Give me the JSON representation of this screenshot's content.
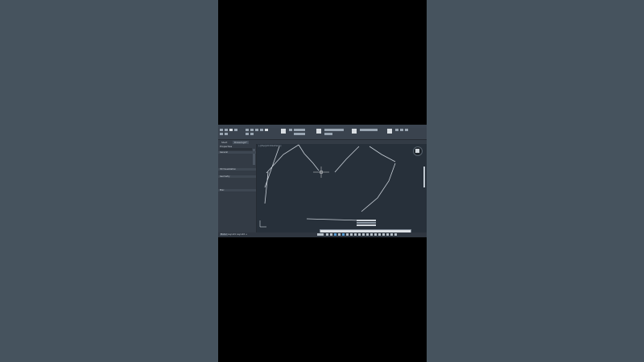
{
  "colors": {
    "letterbox": "#46535e",
    "video_bg": "#000000",
    "app_bg": "#2b323b",
    "viewport_bg": "#27303a",
    "linework": "#c9d0d8",
    "accent": "#5aa0d8"
  },
  "document_tabs": [
    "Start",
    "Drawing1*"
  ],
  "palette": {
    "title": "Properties",
    "sections": [
      "General",
      "3D Visualization",
      "Geometry",
      "Misc"
    ]
  },
  "viewport": {
    "label": "[-][Top][2D Wireframe]"
  },
  "layout_tabs": [
    "Model",
    "Layout1",
    "Layout2",
    "+"
  ],
  "icons": {
    "viewcube": "viewcube-icon",
    "crosshair": "crosshair-cursor-icon",
    "ucs": "ucs-icon"
  }
}
